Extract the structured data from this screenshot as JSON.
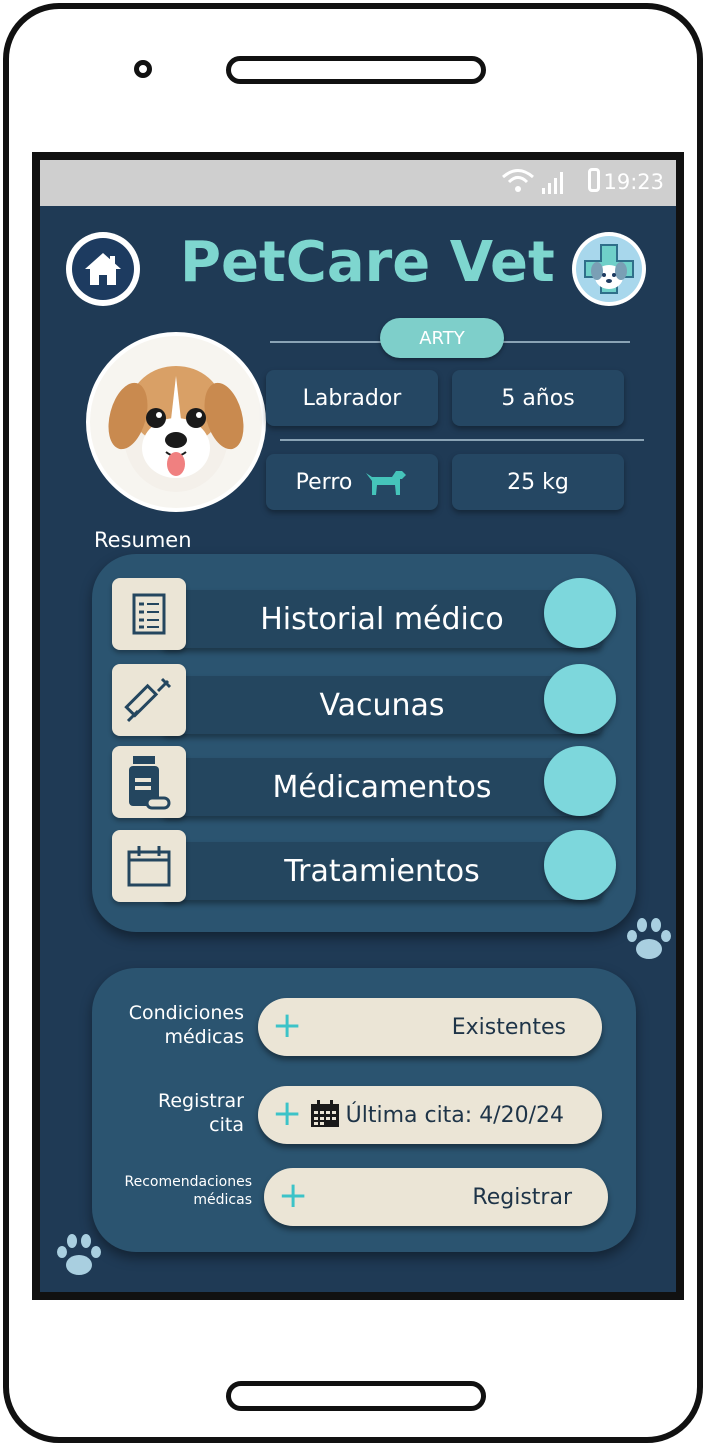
{
  "status_bar": {
    "time": "19:23",
    "wifi_icon": "wifi-icon",
    "signal_icon": "signal-icon",
    "battery_icon": "battery-icon"
  },
  "header": {
    "title": "PetCare Vet",
    "home_icon": "home-icon",
    "logo_icon": "vet-logo-icon"
  },
  "pet": {
    "name": "ARTY",
    "breed": "Labrador",
    "age": "5 años",
    "species": "Perro",
    "weight": "25 kg",
    "species_icon": "dog-icon"
  },
  "summary": {
    "label": "Resumen",
    "items": [
      {
        "label": "Historial médico",
        "icon": "clipboard-list-icon"
      },
      {
        "label": "Vacunas",
        "icon": "syringe-icon"
      },
      {
        "label": "Médicamentos",
        "icon": "medicine-bottle-icon"
      },
      {
        "label": "Tratamientos",
        "icon": "calendar-icon"
      }
    ]
  },
  "actions": {
    "conditions": {
      "label_line1": "Condiciones",
      "label_line2": "médicas",
      "value": "Existentes"
    },
    "appointment": {
      "label_line1": "Registrar",
      "label_line2": "cita",
      "value": "Última cita: 4/20/24"
    },
    "recommendations": {
      "label_line1": "Recomendaciones",
      "label_line2": "médicas",
      "value": "Registrar"
    }
  },
  "colors": {
    "background": "#1f3a55",
    "accent": "#7ed6cf",
    "card": "#2b5470",
    "pill": "#ebe5d6",
    "toggle": "#7dd7dc"
  }
}
